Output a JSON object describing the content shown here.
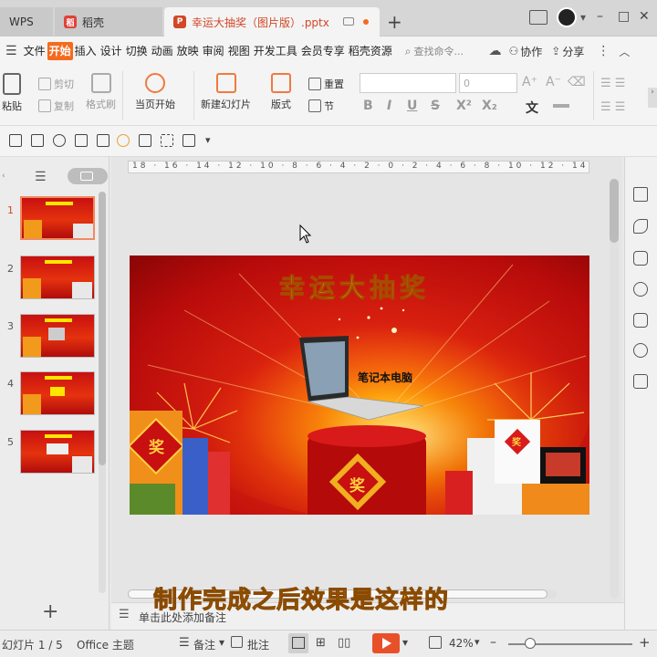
{
  "titlebar": {
    "tabs": [
      {
        "label": "WPS"
      },
      {
        "label": "稻壳"
      },
      {
        "label": "幸运大抽奖（图片版）.pptx"
      }
    ],
    "new_tab": "+",
    "window_controls": [
      "–",
      "□",
      "✕"
    ]
  },
  "menubar": {
    "items": [
      "文件",
      "开始",
      "插入",
      "设计",
      "切换",
      "动画",
      "放映",
      "审阅",
      "视图",
      "开发工具",
      "会员专享",
      "稻壳资源"
    ],
    "active": "开始",
    "search_placeholder": "查找命令...",
    "collab": "协作",
    "share": "分享"
  },
  "ribbon": {
    "paste": "粘贴",
    "cut": "剪切",
    "copy": "复制",
    "format_painter": "格式刷",
    "from_current": "当页开始",
    "new_slide": "新建幻灯片",
    "layout": "版式",
    "reset": "重置",
    "section": "节",
    "font_size": "0",
    "bold": "B",
    "italic": "I",
    "underline": "U",
    "strike": "S",
    "text_fx": "文"
  },
  "ruler": {
    "ticks": "18 · 16 · 14 · 12 · 10 · 8 · 6 · 4 · 2 · 0 · 2 · 4 · 6 · 8 · 10 · 12 · 14 · 16 · 18"
  },
  "slides": [
    {
      "num": "1",
      "selected": true
    },
    {
      "num": "2",
      "selected": false
    },
    {
      "num": "3",
      "selected": false
    },
    {
      "num": "4",
      "selected": false
    },
    {
      "num": "5",
      "selected": false
    }
  ],
  "slide": {
    "title": "幸运大抽奖",
    "prize": "笔记本电脑",
    "box_char": "奖"
  },
  "notes": {
    "placeholder": "单击此处添加备注"
  },
  "overlay": {
    "caption": "制作完成之后效果是这样的"
  },
  "status": {
    "slide_counter": "幻灯片 1 / 5",
    "theme": "Office 主题",
    "notes": "备注",
    "comments": "批注",
    "zoom": "42%",
    "minus": "–",
    "plus": "+"
  },
  "add_slide": "+",
  "colors": {
    "accent": "#d24726",
    "active_menu": "#f56a1e",
    "title_yellow": "#ffe600",
    "caption": "#f5a000",
    "play": "#e8502a"
  }
}
